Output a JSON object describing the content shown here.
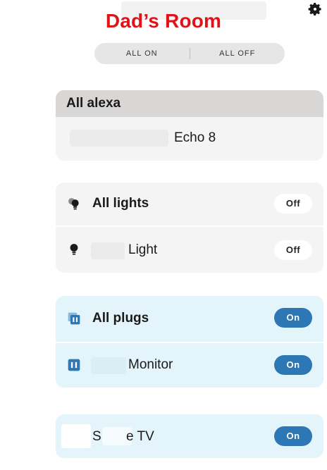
{
  "header": {
    "title": "Dad’s Room",
    "settings_icon": "gear-icon"
  },
  "all_controls": {
    "all_on": "ALL ON",
    "all_off": "ALL OFF"
  },
  "alexa": {
    "heading": "All alexa",
    "device_label": "Echo 8"
  },
  "lights": {
    "group_label": "All lights",
    "group_state": "Off",
    "device_label": "Light",
    "device_state": "Off"
  },
  "plugs": {
    "group_label": "All plugs",
    "group_state": "On",
    "device_label": "Monitor",
    "device_state": "On"
  },
  "tv": {
    "label_prefix": "S",
    "label_suffix": "e TV",
    "state": "On"
  },
  "colors": {
    "title": "#e0121a",
    "on_toggle": "#2d77b5",
    "plug_card": "#e3f4fb"
  }
}
